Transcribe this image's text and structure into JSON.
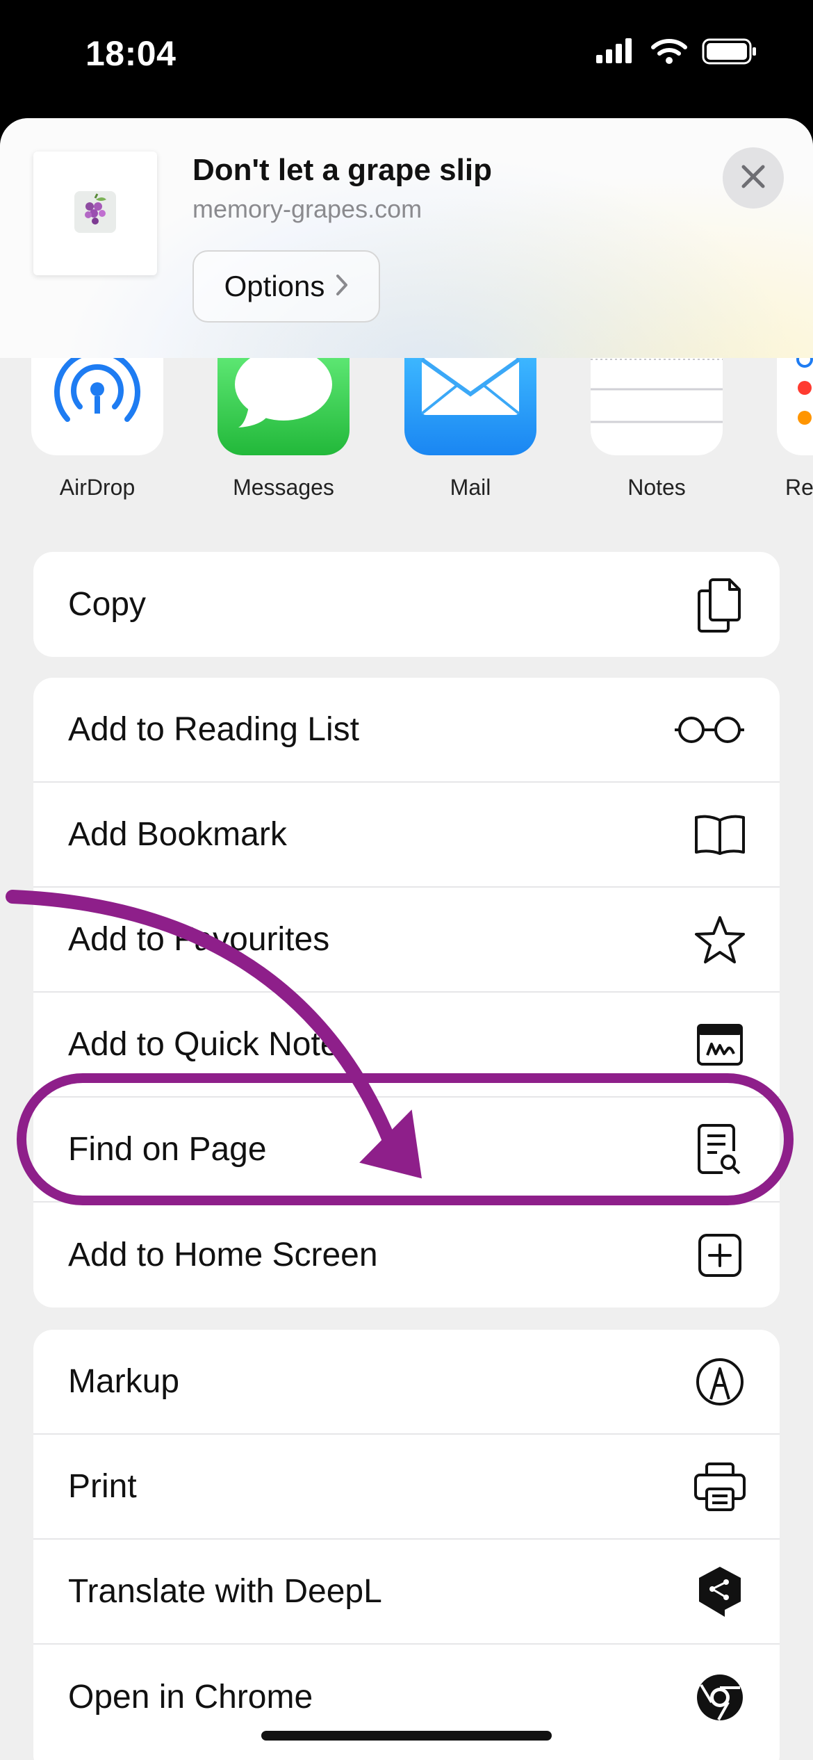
{
  "status_bar": {
    "time": "18:04"
  },
  "share_header": {
    "title": "Don't let a grape slip",
    "url": "memory-grapes.com",
    "options_label": "Options"
  },
  "apps": [
    {
      "label": "AirDrop",
      "icon": "airdrop-icon"
    },
    {
      "label": "Messages",
      "icon": "messages-icon"
    },
    {
      "label": "Mail",
      "icon": "mail-icon"
    },
    {
      "label": "Notes",
      "icon": "notes-icon"
    },
    {
      "label": "Re",
      "icon": "reminders-icon"
    }
  ],
  "actions_top": [
    {
      "label": "Copy",
      "icon": "copy-icon"
    }
  ],
  "actions_middle": [
    {
      "label": "Add to Reading List",
      "icon": "glasses-icon"
    },
    {
      "label": "Add Bookmark",
      "icon": "book-icon"
    },
    {
      "label": "Add to Favourites",
      "icon": "star-icon"
    },
    {
      "label": "Add to Quick Note",
      "icon": "quick-note-icon"
    },
    {
      "label": "Find on Page",
      "icon": "find-on-page-icon"
    },
    {
      "label": "Add to Home Screen",
      "icon": "plus-square-icon"
    }
  ],
  "actions_bottom": [
    {
      "label": "Markup",
      "icon": "markup-icon"
    },
    {
      "label": "Print",
      "icon": "printer-icon"
    },
    {
      "label": "Translate with DeepL",
      "icon": "deepl-icon"
    },
    {
      "label": "Open in Chrome",
      "icon": "chrome-icon"
    }
  ],
  "colors": {
    "highlight": "#8e1f8a",
    "sheet_background": "#efefef",
    "airdrop_blue": "#1e7cf2",
    "messages_green": "#34c759",
    "mail_blue": "#1f9bf7"
  }
}
